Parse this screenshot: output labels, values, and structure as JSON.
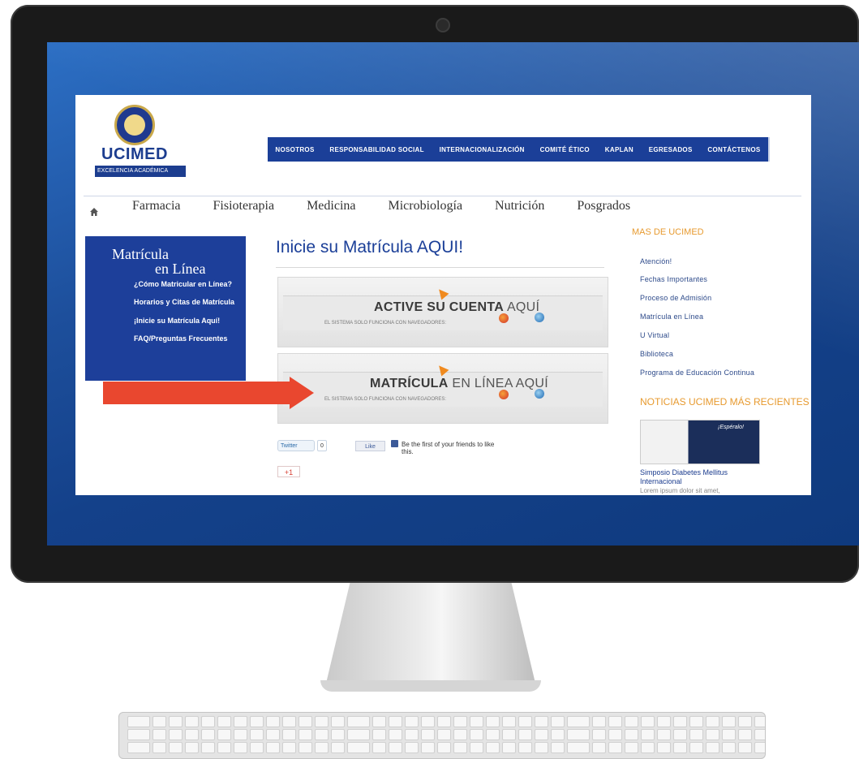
{
  "site": {
    "brand": "UCIMED",
    "tagline": "EXCELENCIA ACADÉMICA"
  },
  "top_nav": [
    "NOSOTROS",
    "RESPONSABILIDAD SOCIAL",
    "INTERNACIONALIZACIÓN",
    "COMITÉ ÉTICO",
    "KAPLAN",
    "EGRESADOS",
    "CONTÁCTENOS"
  ],
  "sub_nav": [
    "Farmacia",
    "Fisioterapia",
    "Medicina",
    "Microbiología",
    "Nutrición",
    "Posgrados"
  ],
  "sidebar": {
    "title_line1": "Matrícula",
    "title_line2": "en Línea",
    "links": [
      "¿Cómo Matricular en Línea?",
      "Horarios y Citas de Matrícula",
      "¡Inicie su Matrícula Aquí!",
      "FAQ/Preguntas Frecuentes"
    ]
  },
  "main": {
    "title": "Inicie su Matrícula AQUI!",
    "banner1": {
      "bold": "ACTIVE SU CUENTA",
      "light": "AQUÍ",
      "sub": "EL SISTEMA SOLO FUNCIONA CON NAVEGADORES:"
    },
    "banner2": {
      "bold": "MATRÍCULA",
      "light": "EN LÍNEA AQUÍ",
      "sub": "EL SISTEMA SOLO FUNCIONA CON NAVEGADORES:"
    }
  },
  "social": {
    "twitter": "Twitter",
    "twitter_count": "0",
    "like": "Like",
    "fb_text": "Be the first of your friends to like this.",
    "gplus": "+1"
  },
  "right": {
    "mas_title": "MAS DE UCIMED",
    "links": [
      "Atención!",
      "Fechas Importantes",
      "Proceso de Admisión",
      "Matrícula en Línea",
      "U Virtual",
      "Biblioteca",
      "Programa de Educación Continua"
    ],
    "news_title": "NOTICIAS UCIMED MÁS RECIENTES",
    "news_image_text": "¡Espéralo!",
    "news_caption": "Simposio Diabetes Mellitus Internacional",
    "news_lorem": "Lorem ipsum dolor sit amet,"
  },
  "colors": {
    "brand_blue": "#1b3f98",
    "accent_orange": "#e79a2f",
    "arrow_red": "#e9472f"
  }
}
